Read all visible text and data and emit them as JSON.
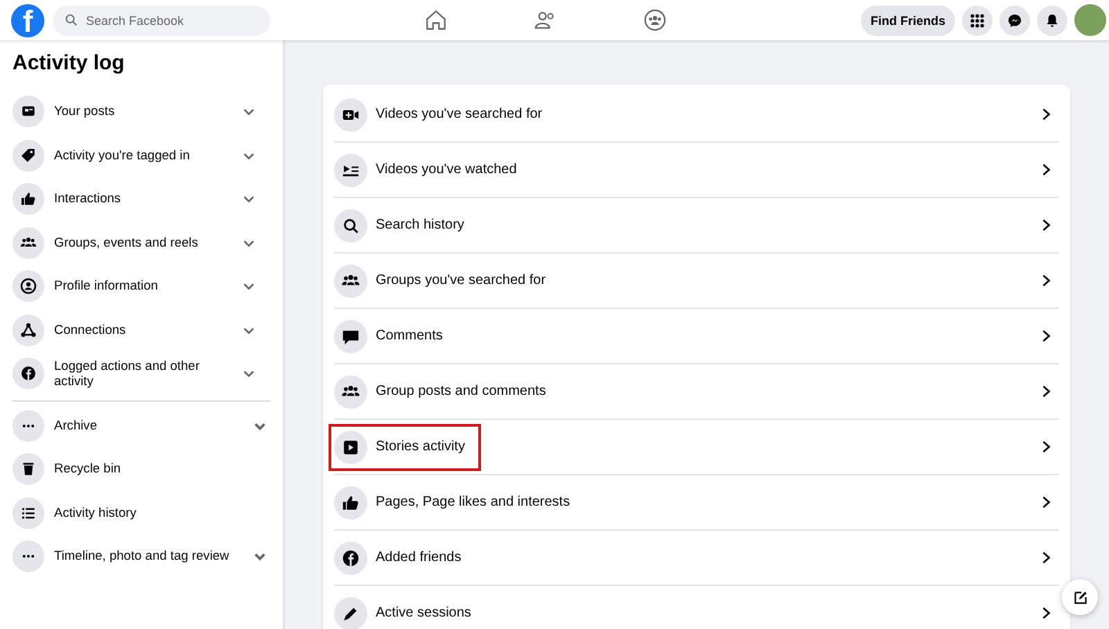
{
  "topbar": {
    "logo": "f",
    "search": {
      "placeholder": "Search Facebook"
    },
    "find_friends": "Find Friends"
  },
  "sidebar": {
    "title": "Activity log",
    "sections": [
      {
        "items": [
          {
            "label": "Your posts",
            "kind": "expandable"
          },
          {
            "label": "Activity you're tagged in",
            "kind": "expandable"
          },
          {
            "label": "Interactions",
            "kind": "expandable"
          },
          {
            "label": "Groups, events and reels",
            "kind": "expandable"
          },
          {
            "label": "Profile information",
            "kind": "expandable"
          },
          {
            "label": "Connections",
            "kind": "expandable"
          },
          {
            "label": "Logged actions and other activity",
            "kind": "expandable"
          }
        ]
      },
      {
        "items": [
          {
            "label": "Archive",
            "kind": "expandable"
          },
          {
            "label": "Recycle bin",
            "kind": "link"
          },
          {
            "label": "Activity history",
            "kind": "link"
          },
          {
            "label": "Timeline, photo and tag review",
            "kind": "expandable"
          }
        ]
      }
    ]
  },
  "main": {
    "items": [
      {
        "label": "Videos you've searched for",
        "highlighted": false
      },
      {
        "label": "Videos you've watched",
        "highlighted": false
      },
      {
        "label": "Search history",
        "highlighted": false
      },
      {
        "label": "Groups you've searched for",
        "highlighted": false
      },
      {
        "label": "Comments",
        "highlighted": false
      },
      {
        "label": "Group posts and comments",
        "highlighted": false
      },
      {
        "label": "Stories activity",
        "highlighted": true
      },
      {
        "label": "Pages, Page likes and interests",
        "highlighted": false
      },
      {
        "label": "Added friends",
        "highlighted": false
      },
      {
        "label": "Active sessions",
        "highlighted": false
      }
    ]
  }
}
